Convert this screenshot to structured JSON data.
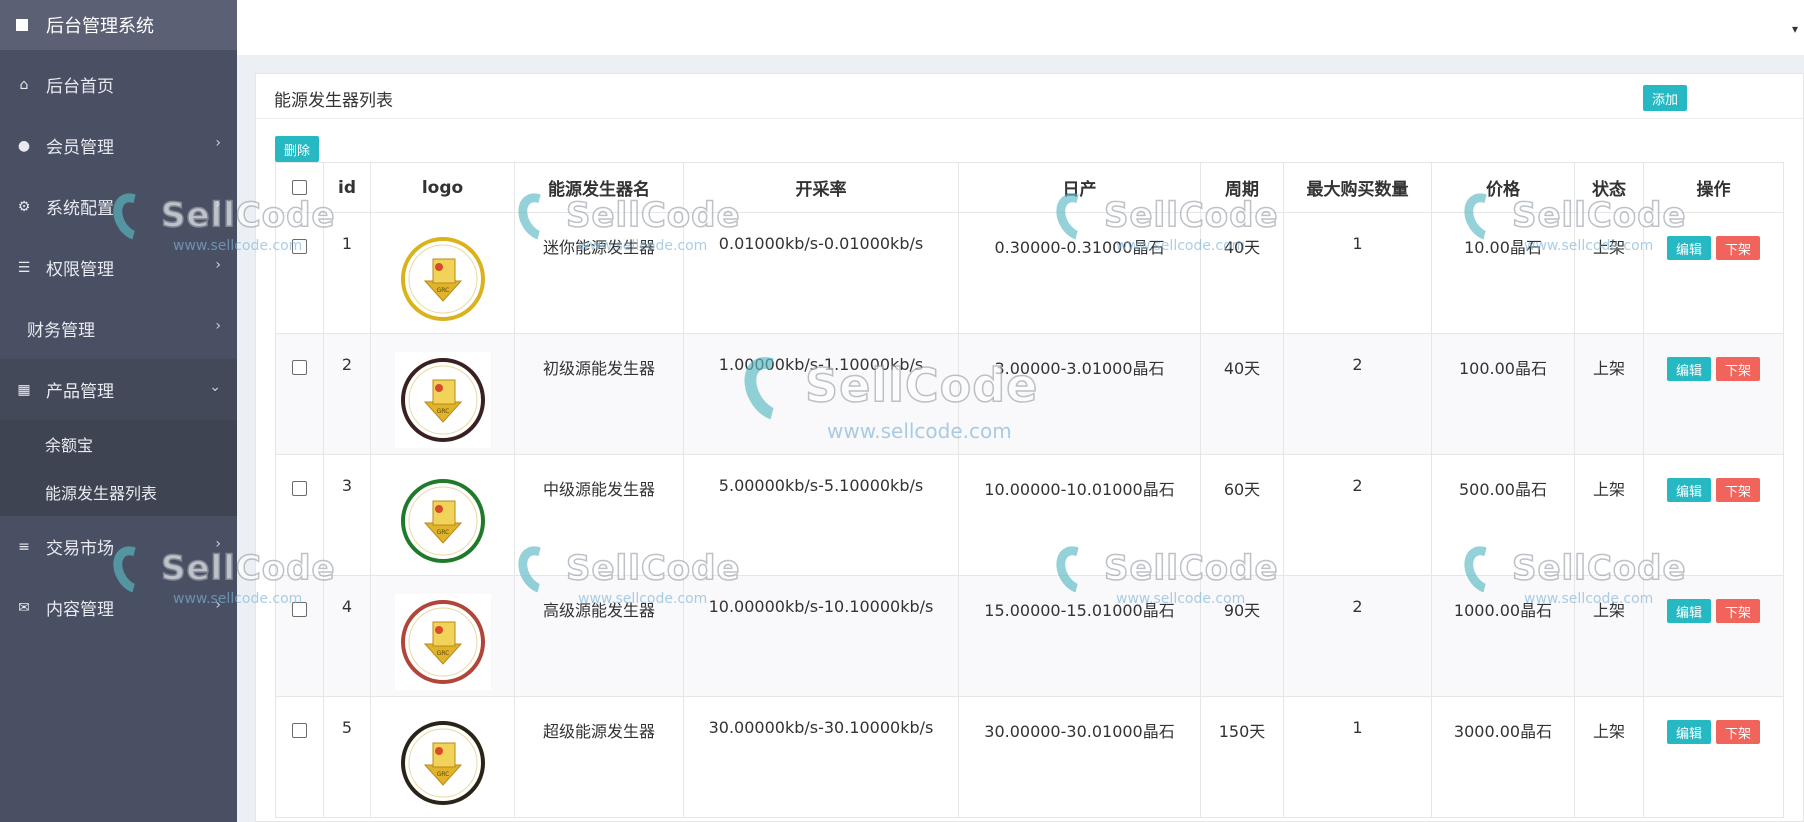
{
  "sidebar": {
    "brand": "后台管理系统",
    "items": [
      {
        "label": "后台首页",
        "icon": "home-icon"
      },
      {
        "label": "会员管理",
        "icon": "user-icon"
      },
      {
        "label": "系统配置",
        "icon": "gears-icon"
      },
      {
        "label": "权限管理",
        "icon": "tasks-icon"
      },
      {
        "label": "财务管理",
        "icon": ""
      },
      {
        "label": "产品管理",
        "icon": "windows-icon"
      },
      {
        "label": "交易市场",
        "icon": "bars-icon"
      },
      {
        "label": "内容管理",
        "icon": "envelope-icon"
      }
    ],
    "sub_items": [
      "余额宝",
      "能源发生器列表"
    ]
  },
  "panel": {
    "title": "能源发生器列表",
    "add_label": "添加",
    "delete_label": "删除"
  },
  "table": {
    "headers": [
      "id",
      "logo",
      "能源发生器名",
      "开采率",
      "日产",
      "周期",
      "最大购买数量",
      "价格",
      "状态",
      "操作"
    ],
    "rows": [
      {
        "id": "1",
        "name": "迷你能源发生器",
        "rate": "0.01000kb/s-0.01000kb/s",
        "daily": "0.30000-0.31000晶石",
        "cycle": "40天",
        "max": "1",
        "price": "10.00晶石",
        "status": "上架",
        "ring": "#d9b21c"
      },
      {
        "id": "2",
        "name": "初级源能发生器",
        "rate": "1.00000kb/s-1.10000kb/s",
        "daily": "3.00000-3.01000晶石",
        "cycle": "40天",
        "max": "2",
        "price": "100.00晶石",
        "status": "上架",
        "ring": "#3a2020"
      },
      {
        "id": "3",
        "name": "中级源能发生器",
        "rate": "5.00000kb/s-5.10000kb/s",
        "daily": "10.00000-10.01000晶石",
        "cycle": "60天",
        "max": "2",
        "price": "500.00晶石",
        "status": "上架",
        "ring": "#1f7a2a"
      },
      {
        "id": "4",
        "name": "高级源能发生器",
        "rate": "10.00000kb/s-10.10000kb/s",
        "daily": "15.00000-15.01000晶石",
        "cycle": "90天",
        "max": "2",
        "price": "1000.00晶石",
        "status": "上架",
        "ring": "#b0453a"
      },
      {
        "id": "5",
        "name": "超级能源发生器",
        "rate": "30.00000kb/s-30.10000kb/s",
        "daily": "30.00000-30.01000晶石",
        "cycle": "150天",
        "max": "1",
        "price": "3000.00晶石",
        "status": "上架",
        "ring": "#2a2418"
      }
    ],
    "edit_label": "编辑",
    "offshelf_label": "下架"
  },
  "watermark": {
    "brand": "SellCode",
    "url": "www.sellcode.com"
  },
  "colors": {
    "sidebar": "#4a5064",
    "accent_teal": "#26b9c4",
    "danger": "#f0645b"
  }
}
